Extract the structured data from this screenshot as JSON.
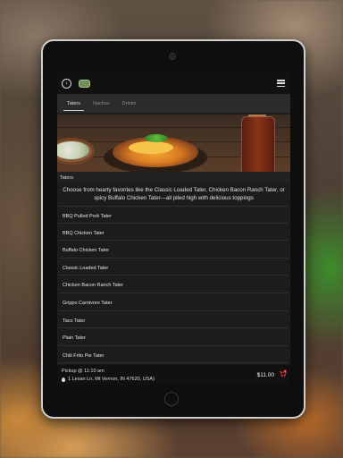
{
  "tabs": [
    {
      "label": "Taters",
      "active": true
    },
    {
      "label": "Nachos",
      "active": false
    },
    {
      "label": "Drinks",
      "active": false
    }
  ],
  "section": {
    "label": "Taters",
    "description": "Choose from hearty favorites like the Classic Loaded Tater, Chicken Bacon Ranch Tater, or spicy Buffalo Chicken Tater—all piled high with delicious toppings"
  },
  "menu_items": [
    {
      "label": "BBQ Pulled Pork Tater"
    },
    {
      "label": "BBQ Chicken Tater"
    },
    {
      "label": "Buffalo Chicken Tater"
    },
    {
      "label": "Classic Loaded Tater"
    },
    {
      "label": "Chicken Bacon Ranch Tater"
    },
    {
      "label": "Grippo Carnivore Tater"
    },
    {
      "label": "Taco Tater"
    },
    {
      "label": "Plain Tater"
    },
    {
      "label": "Chili Frito Pie Tater"
    }
  ],
  "footer": {
    "pickup": "Pickup @ 11:10 am",
    "address": "1 Lexan Ln, Mt Vernon, IN 47620, USA)",
    "total": "$11.00",
    "cart_badge_count": 1
  },
  "icons": {
    "back": "back-arrow-icon",
    "logo": "logo-icon",
    "menu": "hamburger-menu-icon",
    "pin": "location-pin-icon",
    "cart": "cart-icon"
  },
  "colors": {
    "topbar": "#111111",
    "tabs_bg": "#2b2b2b",
    "list_bg": "#1c1c1c",
    "cart_accent": "#e23b3b"
  }
}
